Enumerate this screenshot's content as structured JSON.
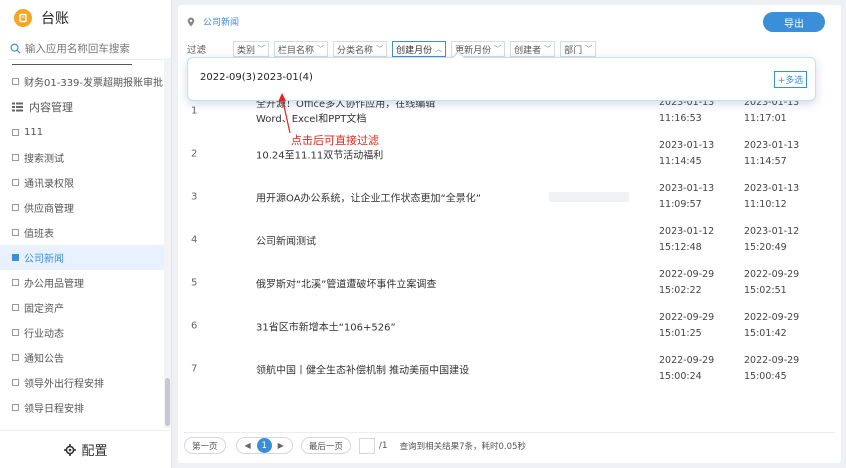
{
  "app": {
    "title": "台账"
  },
  "sidebar": {
    "search_placeholder": "输入应用名称回车搜索",
    "top_items": [
      {
        "label": "财务01-339-发票超期报账审批..."
      }
    ],
    "group": {
      "label": "内容管理"
    },
    "items": [
      {
        "label": "111",
        "active": false
      },
      {
        "label": "搜索测试",
        "active": false
      },
      {
        "label": "通讯录权限",
        "active": false
      },
      {
        "label": "供应商管理",
        "active": false
      },
      {
        "label": "值班表",
        "active": false
      },
      {
        "label": "公司新闻",
        "active": true
      },
      {
        "label": "办公用品管理",
        "active": false
      },
      {
        "label": "固定资产",
        "active": false
      },
      {
        "label": "行业动态",
        "active": false
      },
      {
        "label": "通知公告",
        "active": false
      },
      {
        "label": "领导外出行程安排",
        "active": false
      },
      {
        "label": "领导日程安排",
        "active": false
      }
    ],
    "footer_label": "配置"
  },
  "header": {
    "breadcrumb": "公司新闻",
    "export_label": "导出"
  },
  "filters": {
    "label": "过滤",
    "chips": [
      {
        "label": "类别",
        "open": false
      },
      {
        "label": "栏目名称",
        "open": false
      },
      {
        "label": "分类名称",
        "open": false
      },
      {
        "label": "创建月份",
        "open": true
      },
      {
        "label": "更新月份",
        "open": false
      },
      {
        "label": "创建者",
        "open": false
      },
      {
        "label": "部门",
        "open": false
      }
    ]
  },
  "popover": {
    "options": [
      "2022-09(3)",
      "2023-01(4)"
    ],
    "multi_label": "+多选"
  },
  "annotation": {
    "text": "点击后可直接过滤",
    "color": "#e1251b"
  },
  "rows": [
    {
      "num": "1",
      "title": "全开源！Office多人协作应用，在线编辑Word、Excel和PPT文档",
      "created_date": "2023-01-13",
      "created_time": "11:16:53",
      "updated_date": "2023-01-13",
      "updated_time": "11:17:01"
    },
    {
      "num": "2",
      "title": "10.24至11.11双节活动福利",
      "created_date": "2023-01-13",
      "created_time": "11:14:45",
      "updated_date": "2023-01-13",
      "updated_time": "11:14:57"
    },
    {
      "num": "3",
      "title": "用开源OA办公系统，让企业工作状态更加“全景化”",
      "created_date": "2023-01-13",
      "created_time": "11:09:57",
      "updated_date": "2023-01-13",
      "updated_time": "11:10:12"
    },
    {
      "num": "4",
      "title": "公司新闻测试",
      "created_date": "2023-01-12",
      "created_time": "15:12:48",
      "updated_date": "2023-01-12",
      "updated_time": "15:20:49"
    },
    {
      "num": "5",
      "title": "俄罗斯对“北溪”管道遭破坏事件立案调查",
      "created_date": "2022-09-29",
      "created_time": "15:02:22",
      "updated_date": "2022-09-29",
      "updated_time": "15:02:51"
    },
    {
      "num": "6",
      "title": "31省区市新增本土“106+526”",
      "created_date": "2022-09-29",
      "created_time": "15:01:25",
      "updated_date": "2022-09-29",
      "updated_time": "15:01:42"
    },
    {
      "num": "7",
      "title": "领航中国丨健全生态补偿机制 推动美丽中国建设",
      "created_date": "2022-09-29",
      "created_time": "15:00:24",
      "updated_date": "2022-09-29",
      "updated_time": "15:00:45"
    }
  ],
  "pagination": {
    "first_label": "第一页",
    "prev_icon": "◀",
    "current_page": "1",
    "next_icon": "▶",
    "last_label": "最后一页",
    "total_pages": "/1",
    "info": "查询到相关结果7条，耗时0.05秒"
  },
  "colors": {
    "accent": "#3b8fd9",
    "logo": "#f5a623",
    "annotation": "#e1251b"
  }
}
